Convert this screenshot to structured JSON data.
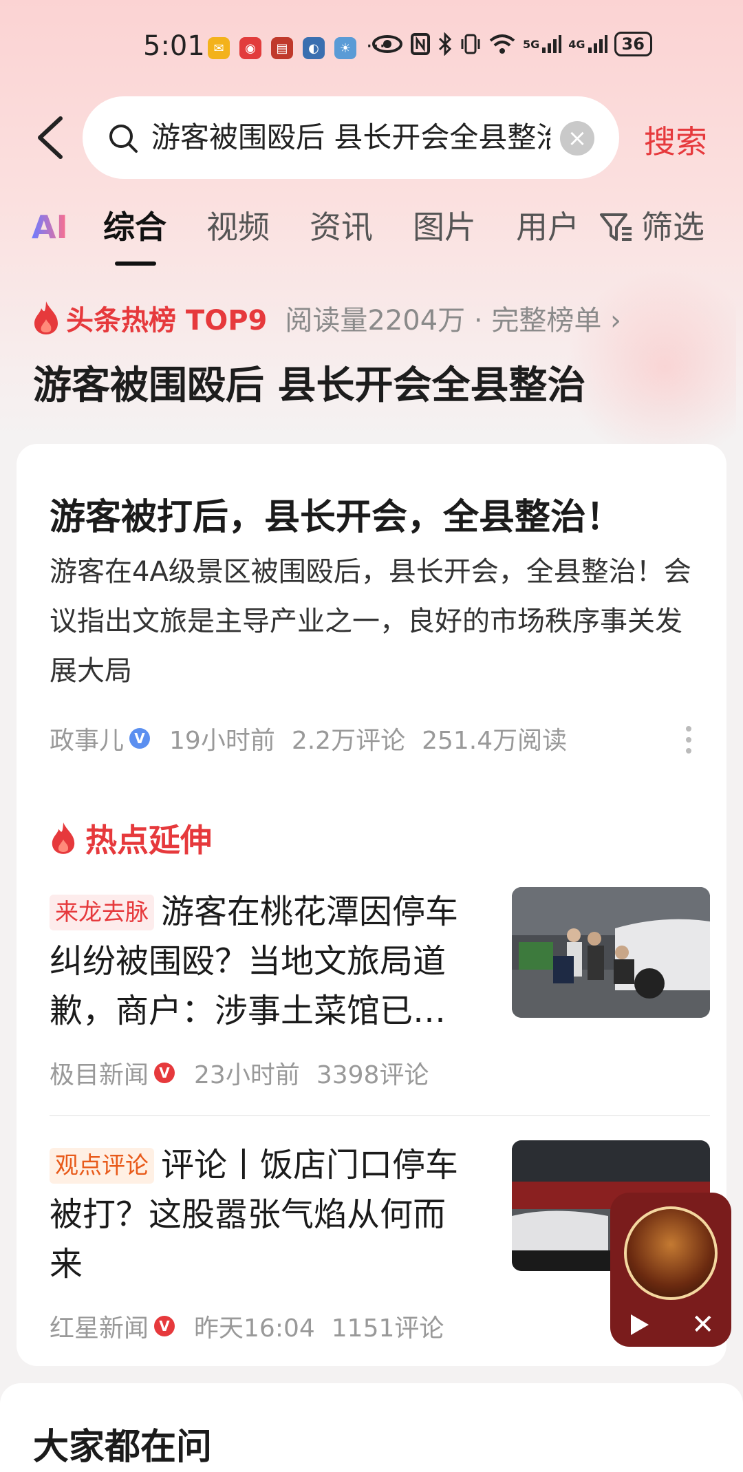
{
  "status_bar": {
    "time": "5:01",
    "battery": "36",
    "network_a": "5G",
    "network_b": "4G",
    "more": "···"
  },
  "search": {
    "query": "游客被围殴后 县长开会全县整治",
    "submit_label": "搜索"
  },
  "tabs": [
    {
      "label": "AI"
    },
    {
      "label": "综合"
    },
    {
      "label": "视频"
    },
    {
      "label": "资讯"
    },
    {
      "label": "图片"
    },
    {
      "label": "用户"
    },
    {
      "label": "筛选"
    }
  ],
  "hot_rank": {
    "label": "头条热榜 TOP9",
    "reads": "阅读量2204万 · 完整榜单 ›",
    "title": "游客被围殴后 县长开会全县整治"
  },
  "main_article": {
    "title": "游客被打后，县长开会，全县整治！",
    "summary": "游客在4A级景区被围殴后，县长开会，全县整治！会议指出文旅是主导产业之一，良好的市场秩序事关发展大局",
    "source": "政事儿",
    "badge": "V",
    "time": "19小时前",
    "comments": "2.2万评论",
    "reads": "251.4万阅读"
  },
  "hot_extension": {
    "label": "热点延伸",
    "items": [
      {
        "tag": "来龙去脉",
        "title": "游客在桃花潭因停车纠纷被围殴？当地文旅局道歉，商户：涉事土菜馆已…",
        "source": "极目新闻",
        "badge": "V",
        "time": "23小时前",
        "comments": "3398评论"
      },
      {
        "tag": "观点评论",
        "title": "评论丨饭店门口停车被打？这股嚣张气焰从何而来",
        "source": "红星新闻",
        "badge": "V",
        "time": "昨天16:04",
        "comments": "1151评论"
      }
    ]
  },
  "second_card": {
    "title": "大家都在问"
  },
  "colors": {
    "accent": "#e6393c",
    "meta_gray": "#999999",
    "player_bg": "#7a1c1c"
  }
}
